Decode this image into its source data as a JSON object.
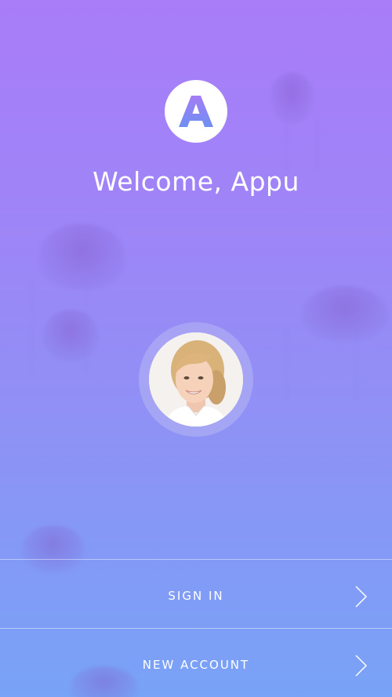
{
  "app": {
    "logo_letter": "A",
    "logo_icon": "app-logo-a"
  },
  "welcome": {
    "title": "Welcome, Appu"
  },
  "profile": {
    "avatar_icon": "user-avatar-photo"
  },
  "actions": {
    "sign_in_label": "SIGN IN",
    "new_account_label": "NEW ACCOUNT",
    "chevron_icon": "chevron-right-icon"
  },
  "colors": {
    "gradient_top": "#a97cf8",
    "gradient_bottom": "#78a3f6",
    "logo_gradient_top": "#a57cf5",
    "logo_gradient_bottom": "#6f8ff3",
    "text": "#ffffff"
  }
}
